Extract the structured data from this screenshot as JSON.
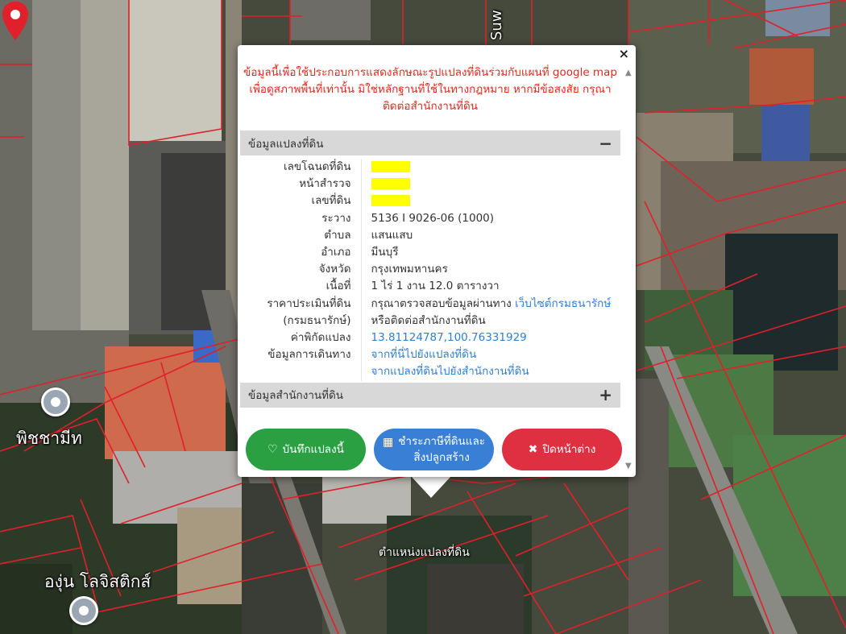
{
  "map": {
    "poi_labels": [
      "พิชชามีท",
      "องุ่น โลจิสติกส์"
    ],
    "road_label": "Suw",
    "parcel_label": "ตำแหน่งแปลงที่ดิน",
    "parcel_line_color": "#e0202a"
  },
  "popup": {
    "close_label": "×",
    "warning_text": "ข้อมูลนี้เพื่อใช้ประกอบการแสดงลักษณะรูปแปลงที่ดินร่วมกับแผนที่ google map เพื่อดูสภาพพื้นที่เท่านั้น มิใช่หลักฐานที่ใช้ในทางกฎหมาย หากมีข้อสงสัย กรุณาติดต่อสำนักงานที่ดิน",
    "section_land": {
      "title": "ข้อมูลแปลงที่ดิน",
      "sign": "−"
    },
    "section_office": {
      "title": "ข้อมูลสำนักงานที่ดิน",
      "sign": "+"
    },
    "fields": {
      "deed_no_label": "เลขโฉนดที่ดิน",
      "survey_page_label": "หน้าสำรวจ",
      "land_no_label": "เลขที่ดิน",
      "map_sheet_label": "ระวาง",
      "map_sheet_value": "5136 I 9026-06 (1000)",
      "subdistrict_label": "ตำบล",
      "subdistrict_value": "แสนแสบ",
      "district_label": "อำเภอ",
      "district_value": "มีนบุรี",
      "province_label": "จังหวัด",
      "province_value": "กรุงเทพมหานคร",
      "area_label": "เนื้อที่",
      "area_value": "1 ไร่ 1 งาน 12.0 ตารางวา",
      "appraisal_label_1": "ราคาประเมินที่ดิน",
      "appraisal_label_2": "(กรมธนารักษ์)",
      "appraisal_value_1": "กรุณาตรวจสอบข้อมูลผ่านทาง",
      "appraisal_link": "เว็บไซต์กรมธนารักษ์",
      "appraisal_value_2": "หรือติดต่อสำนักงานที่ดิน",
      "coords_label": "ค่าพิกัดแปลง",
      "coords_value": "13.81124787,100.76331929",
      "travel_label": "ข้อมูลการเดินทาง",
      "travel_link_1": "จากที่นี่ไปยังแปลงที่ดิน",
      "travel_link_2": "จากแปลงที่ดินไปยังสำนักงานที่ดิน"
    },
    "buttons": {
      "save_label": "บันทึกแปลงนี้",
      "tax_label_1": "ชำระภาษีที่ดินและ",
      "tax_label_2": "สิ่งปลูกสร้าง",
      "close_label": "ปิดหน้าต่าง"
    },
    "colors": {
      "warning": "#e8271e",
      "save": "#2aa043",
      "tax": "#3a7fd6",
      "close": "#de3040",
      "redaction": "#ffff00",
      "link": "#2f7fd0"
    }
  }
}
